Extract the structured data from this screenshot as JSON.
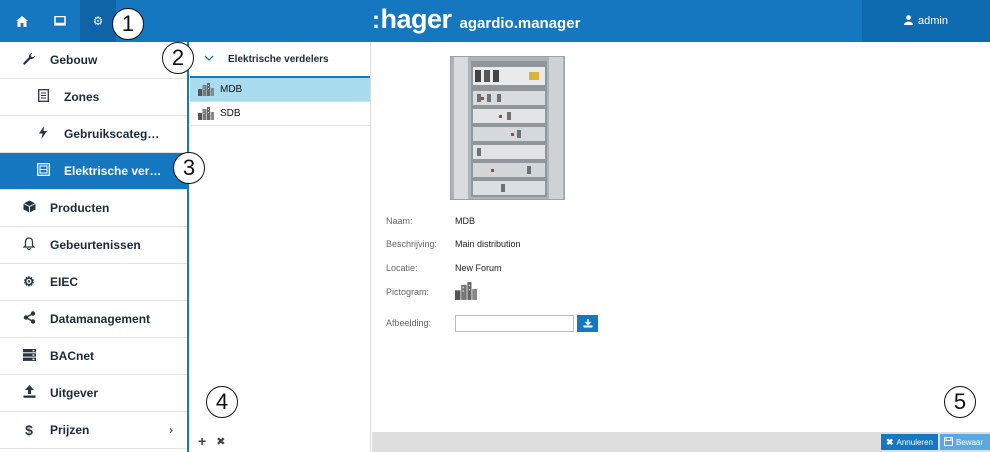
{
  "topbar": {
    "nav_icons": [
      "home-icon",
      "monitor-icon",
      "settings-gears-icon"
    ],
    "brand_logo": "hager",
    "brand_sub": "agardio.manager",
    "user_label": "admin"
  },
  "sidebar": {
    "items": [
      {
        "label": "Gebouw",
        "icon": "wrench-icon"
      },
      {
        "label": "Zones",
        "icon": "zones-icon"
      },
      {
        "label": "Gebruikscateg…",
        "icon": "lightning-icon"
      },
      {
        "label": "Elektrische ver…",
        "icon": "panel-icon"
      },
      {
        "label": "Producten",
        "icon": "box-icon"
      },
      {
        "label": "Gebeurtenissen",
        "icon": "bell-icon"
      },
      {
        "label": "EIEC",
        "icon": "gears-icon"
      },
      {
        "label": "Datamanagement",
        "icon": "share-icon"
      },
      {
        "label": "BACnet",
        "icon": "server-icon"
      },
      {
        "label": "Uitgever",
        "icon": "upload-icon"
      },
      {
        "label": "Prijzen",
        "icon": "dollar-icon"
      }
    ]
  },
  "list": {
    "header": "Elektrische verdelers",
    "items": [
      "MDB",
      "SDB"
    ]
  },
  "detail": {
    "fields": [
      {
        "label": "Naam:",
        "value": "MDB"
      },
      {
        "label": "Beschrijving:",
        "value": "Main distribution"
      },
      {
        "label": "Locatie:",
        "value": "New Forum"
      },
      {
        "label": "Pictogram:",
        "value": ""
      },
      {
        "label": "Afbeelding:",
        "value": ""
      }
    ],
    "cancel_label": "Annuleren",
    "save_label": "Bewaar"
  },
  "callouts": [
    "1",
    "2",
    "3",
    "4",
    "5"
  ],
  "colors": {
    "accent": "#1577c0",
    "selected_row": "#a9dcef",
    "footer": "#dedede"
  }
}
